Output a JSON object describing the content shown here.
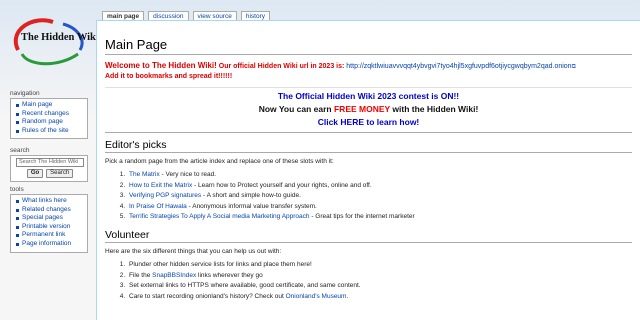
{
  "logo": {
    "text": "The Hidden Wiki"
  },
  "tabs": [
    {
      "label": "main page"
    },
    {
      "label": "discussion"
    },
    {
      "label": "view source"
    },
    {
      "label": "history"
    }
  ],
  "sidebar": {
    "navigation": {
      "title": "navigation",
      "items": [
        "Main page",
        "Recent changes",
        "Random page",
        "Rules of the site"
      ]
    },
    "search": {
      "title": "search",
      "placeholder": "Search The Hidden Wiki",
      "go_label": "Go",
      "search_label": "Search"
    },
    "tools": {
      "title": "tools",
      "items": [
        "What links here",
        "Related changes",
        "Special pages",
        "Printable version",
        "Permanent link",
        "Page information"
      ]
    }
  },
  "main": {
    "title": "Main Page",
    "welcome": {
      "lead": "Welcome to The Hidden Wiki!",
      "text": "Our official Hidden Wiki url in 2023 is:",
      "url": "http://zqktlwiuavvvqqt4ybvgvi7tyo4hjl5xgfuvpdf6otjiycgwqbym2qad.onion",
      "bookmark": "Add it to bookmarks and spread it!!!!!!"
    },
    "contest": {
      "line1": "The Official Hidden Wiki 2023 contest is ON!!",
      "line2_pre": "Now You can earn",
      "line2_money": "FREE MONEY",
      "line2_post": "with the Hidden Wiki!",
      "line3": "Click HERE to learn how!"
    },
    "editors": {
      "heading": "Editor's picks",
      "intro": "Pick a random page from the article index and replace one of these slots with it:",
      "items": [
        {
          "link": "The Matrix",
          "text": " - Very nice to read."
        },
        {
          "link": "How to Exit the Matrix",
          "text": " - Learn how to Protect yourself and your rights, online and off."
        },
        {
          "link": "Verifying PGP signatures",
          "text": " - A short and simple how-to guide."
        },
        {
          "link": "In Praise Of Hawala",
          "text": " - Anonymous informal value transfer system."
        },
        {
          "link": "Terrific Strategies To Apply A Social media Marketing Approach",
          "text": " - Great tips for the internet marketer"
        }
      ]
    },
    "volunteer": {
      "heading": "Volunteer",
      "intro": "Here are the six different things that you can help us out with:",
      "items": [
        {
          "pre": "Plunder other hidden service lists for links and place them here!",
          "link": "",
          "post": ""
        },
        {
          "pre": "File the ",
          "link": "SnapBBSIndex",
          "post": " links wherever they go"
        },
        {
          "pre": "Set external links to HTTPS where available, good certificate, and same content.",
          "link": "",
          "post": ""
        },
        {
          "pre": "Care to start recording onionland's history? Check out ",
          "link": "Onionland's Museum",
          "post": "."
        }
      ]
    }
  }
}
